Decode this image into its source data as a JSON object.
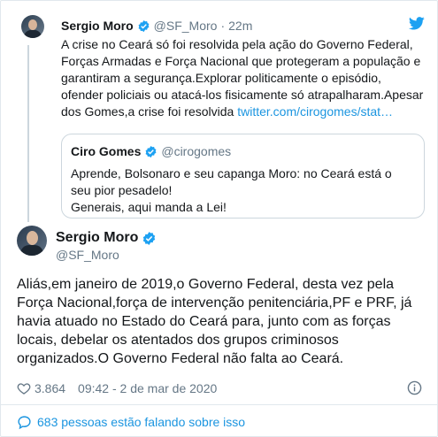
{
  "parent_tweet": {
    "name": "Sergio Moro",
    "handle": "@SF_Moro",
    "time": "22m",
    "text": "A crise no Ceará só foi resolvida pela ação do Governo Federal, Forças Armadas e Força Nacional que protegeram a população e garantiram a segurança.Explorar politicamente o episódio, ofender policiais ou atacá-los fisicamente só atrapalharam.Apesar dos Gomes,a crise foi resolvida ",
    "link": "twitter.com/cirogomes/stat…"
  },
  "quoted_tweet": {
    "name": "Ciro Gomes",
    "handle": "@cirogomes",
    "text_line1": "Aprende, Bolsonaro e seu capanga Moro: no Ceará está o seu pior pesadelo!",
    "text_line2": "Generais, aqui manda a Lei!"
  },
  "main_tweet": {
    "name": "Sergio Moro",
    "handle": "@SF_Moro",
    "text": "Aliás,em janeiro de 2019,o Governo Federal, desta vez pela Força Nacional,força de intervenção penitenciária,PF e PRF, já havia atuado no Estado do Ceará para, junto com as forças locais, debelar os atentados dos grupos criminosos organizados.O Governo Federal não falta ao Ceará.",
    "likes": "3.864",
    "timestamp": "09:42 - 2 de mar de 2020"
  },
  "footer": {
    "conversation": "683 pessoas estão falando sobre isso"
  },
  "colors": {
    "accent": "#1b95e0",
    "muted": "#657786",
    "verified": "#1da1f2",
    "border": "#e1e8ed"
  },
  "icons": [
    "twitter-bird-icon",
    "verified-badge-icon",
    "heart-icon",
    "info-icon",
    "speech-bubble-icon"
  ]
}
